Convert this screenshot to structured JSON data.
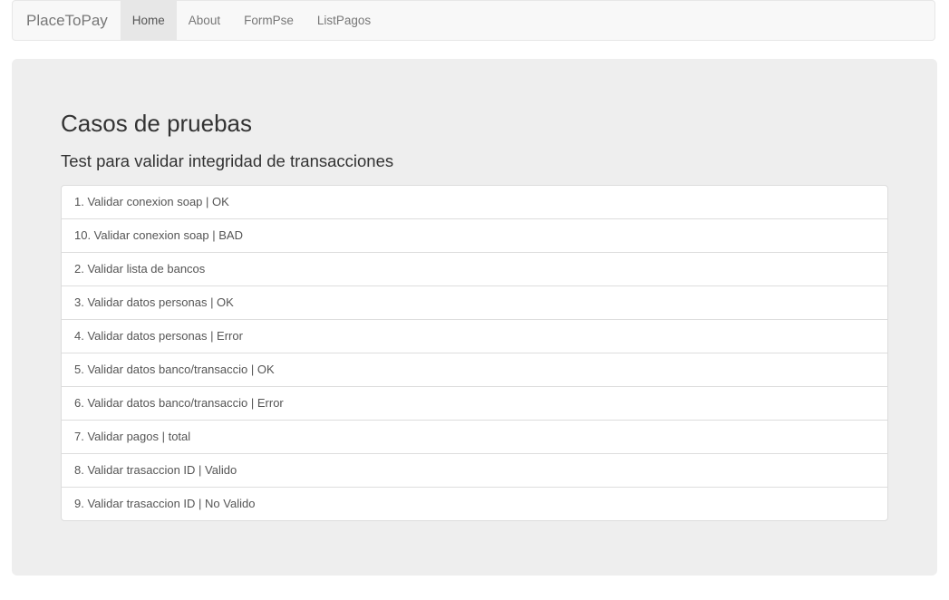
{
  "navbar": {
    "brand": "PlaceToPay",
    "items": [
      {
        "label": "Home",
        "active": true
      },
      {
        "label": "About",
        "active": false
      },
      {
        "label": "FormPse",
        "active": false
      },
      {
        "label": "ListPagos",
        "active": false
      }
    ]
  },
  "main": {
    "title": "Casos de pruebas",
    "subtitle": "Test para validar integridad de transacciones",
    "tests": [
      "1. Validar conexion soap | OK",
      "10. Validar conexion soap | BAD",
      "2. Validar lista de bancos",
      "3. Validar datos personas | OK",
      "4. Validar datos personas | Error",
      "5. Validar datos banco/transaccio | OK",
      "6. Validar datos banco/transaccio | Error",
      "7. Validar pagos | total",
      "8. Validar trasaccion ID | Valido",
      "9. Validar trasaccion ID | No Valido"
    ]
  },
  "colors": {
    "navbar_bg": "#f8f8f8",
    "active_tab_bg": "#e7e7e7",
    "jumbotron_bg": "#eeeeee",
    "text": "#333333"
  }
}
